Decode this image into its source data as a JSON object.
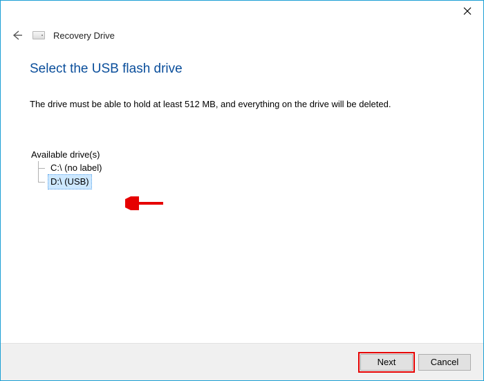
{
  "window": {
    "title": "Recovery Drive"
  },
  "page": {
    "heading": "Select the USB flash drive",
    "instruction": "The drive must be able to hold at least 512 MB, and everything on the drive will be deleted."
  },
  "drives": {
    "label": "Available drive(s)",
    "items": [
      {
        "text": "C:\\ (no label)",
        "selected": false
      },
      {
        "text": "D:\\ (USB)",
        "selected": true
      }
    ]
  },
  "footer": {
    "next": "Next",
    "cancel": "Cancel"
  }
}
